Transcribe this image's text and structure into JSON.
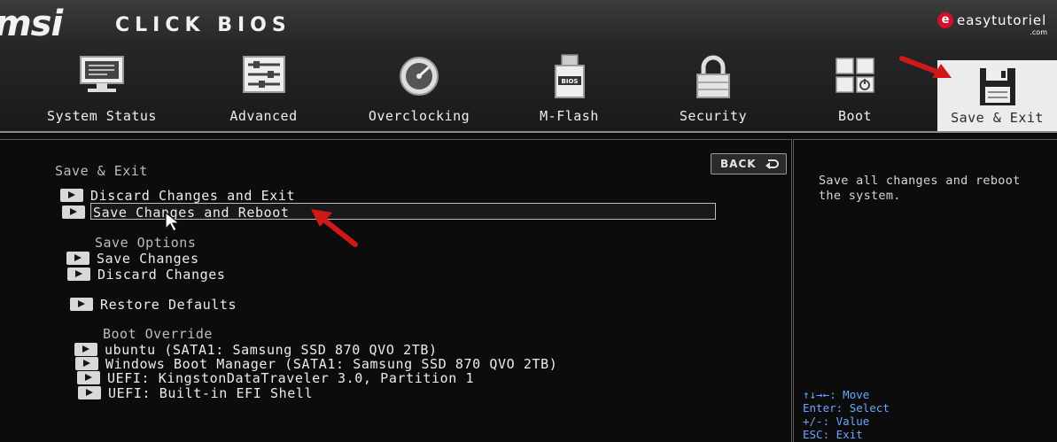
{
  "header": {
    "brand": "msi",
    "product": "CLICK BIOS",
    "watermark": {
      "logo_letter": "e",
      "text": "easytutoriel",
      "suffix": ".com"
    },
    "tabs": [
      {
        "label": "System Status",
        "icon": "monitor-icon"
      },
      {
        "label": "Advanced",
        "icon": "settings-panel-icon"
      },
      {
        "label": "Overclocking",
        "icon": "speedometer-icon"
      },
      {
        "label": "M-Flash",
        "icon": "usb-drive-icon",
        "icon_text": "BIOS"
      },
      {
        "label": "Security",
        "icon": "padlock-icon"
      },
      {
        "label": "Boot",
        "icon": "boot-keys-icon"
      },
      {
        "label": "Save & Exit",
        "icon": "floppy-disk-icon",
        "active": true
      }
    ]
  },
  "main": {
    "title": "Save & Exit",
    "back_label": "BACK",
    "items": [
      {
        "label": "Discard Changes and Exit"
      },
      {
        "label": "Save Changes and Reboot",
        "selected": true
      }
    ],
    "save_options": {
      "title": "Save Options",
      "items": [
        {
          "label": "Save Changes"
        },
        {
          "label": "Discard Changes"
        }
      ]
    },
    "restore": {
      "label": "Restore Defaults"
    },
    "boot_override": {
      "title": "Boot Override",
      "items": [
        {
          "label": "ubuntu (SATA1: Samsung SSD 870 QVO 2TB)"
        },
        {
          "label": "Windows Boot Manager (SATA1: Samsung SSD 870 QVO 2TB)"
        },
        {
          "label": "UEFI: KingstonDataTraveler 3.0, Partition 1"
        },
        {
          "label": "UEFI: Built-in EFI Shell"
        }
      ]
    }
  },
  "help": {
    "text": "Save all changes and reboot the system.",
    "keys": [
      {
        "key": "↑↓→←:",
        "desc": "Move"
      },
      {
        "key": "Enter:",
        "desc": "Select"
      },
      {
        "key": "+/-:",
        "desc": "Value"
      },
      {
        "key": "ESC:",
        "desc": "Exit"
      }
    ]
  },
  "colors": {
    "accent_key": "#6aa6ff",
    "highlight_arrow": "#d01818",
    "active_tab": "#ececec"
  }
}
